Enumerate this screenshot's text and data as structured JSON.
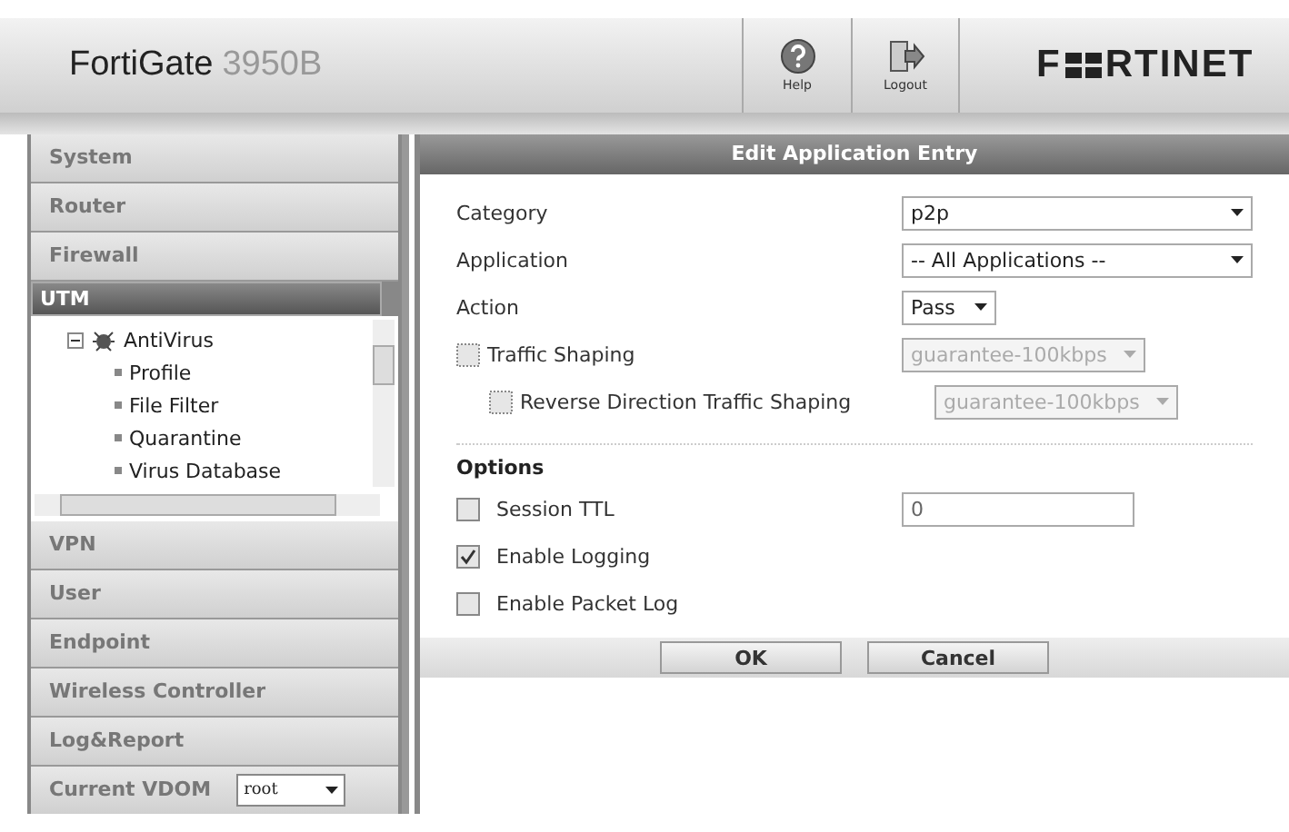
{
  "header": {
    "product": "FortiGate",
    "model": "3950B",
    "buttons": [
      {
        "kind": "help",
        "label": "Help"
      },
      {
        "kind": "logout",
        "label": "Logout"
      }
    ],
    "logo": {
      "before": "F",
      "after": "RTINET"
    }
  },
  "sidebar": {
    "items": [
      {
        "label": "System",
        "selected": false
      },
      {
        "label": "Router",
        "selected": false
      },
      {
        "label": "Firewall",
        "selected": false
      },
      {
        "label": "UTM",
        "selected": true,
        "children": [
          {
            "label": "AntiVirus",
            "expanded": true,
            "children": [
              {
                "label": "Profile"
              },
              {
                "label": "File Filter"
              },
              {
                "label": "Quarantine"
              },
              {
                "label": "Virus Database"
              }
            ]
          }
        ]
      },
      {
        "label": "VPN",
        "selected": false
      },
      {
        "label": "User",
        "selected": false
      },
      {
        "label": "Endpoint",
        "selected": false
      },
      {
        "label": "Wireless Controller",
        "selected": false
      },
      {
        "label": "Log&Report",
        "selected": false
      }
    ],
    "vdom": {
      "label": "Current VDOM",
      "value": "root"
    }
  },
  "dialog": {
    "title": "Edit Application Entry",
    "fields": [
      {
        "kind": "select",
        "label": "Category",
        "value": "p2p",
        "disabled": false
      },
      {
        "kind": "select",
        "label": "Application",
        "value": "-- All Applications --",
        "disabled": false
      },
      {
        "kind": "short-select",
        "label": "Action",
        "value": "Pass",
        "disabled": false
      },
      {
        "kind": "check-select",
        "label": "Traffic Shaping",
        "checked": false,
        "value": "guarantee-100kbps",
        "disabled": true,
        "indent": false
      },
      {
        "kind": "check-select",
        "label": "Reverse Direction Traffic Shaping",
        "checked": false,
        "value": "guarantee-100kbps",
        "disabled": true,
        "indent": true
      }
    ],
    "options_title": "Options",
    "options": [
      {
        "kind": "check-input",
        "label": "Session TTL",
        "checked": false,
        "value": "0"
      },
      {
        "kind": "check",
        "label": "Enable Logging",
        "checked": true
      },
      {
        "kind": "check",
        "label": "Enable Packet Log",
        "checked": false
      }
    ],
    "buttons": [
      "OK",
      "Cancel"
    ]
  }
}
